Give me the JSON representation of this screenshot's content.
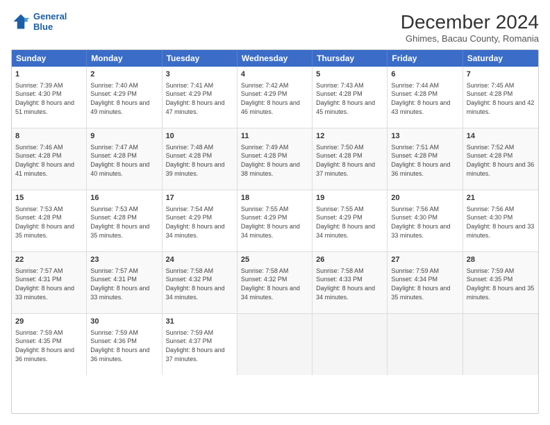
{
  "logo": {
    "line1": "General",
    "line2": "Blue"
  },
  "title": "December 2024",
  "subtitle": "Ghimes, Bacau County, Romania",
  "header_days": [
    "Sunday",
    "Monday",
    "Tuesday",
    "Wednesday",
    "Thursday",
    "Friday",
    "Saturday"
  ],
  "weeks": [
    [
      {
        "day": "1",
        "sunrise": "Sunrise: 7:39 AM",
        "sunset": "Sunset: 4:30 PM",
        "daylight": "Daylight: 8 hours and 51 minutes."
      },
      {
        "day": "2",
        "sunrise": "Sunrise: 7:40 AM",
        "sunset": "Sunset: 4:29 PM",
        "daylight": "Daylight: 8 hours and 49 minutes."
      },
      {
        "day": "3",
        "sunrise": "Sunrise: 7:41 AM",
        "sunset": "Sunset: 4:29 PM",
        "daylight": "Daylight: 8 hours and 47 minutes."
      },
      {
        "day": "4",
        "sunrise": "Sunrise: 7:42 AM",
        "sunset": "Sunset: 4:29 PM",
        "daylight": "Daylight: 8 hours and 46 minutes."
      },
      {
        "day": "5",
        "sunrise": "Sunrise: 7:43 AM",
        "sunset": "Sunset: 4:28 PM",
        "daylight": "Daylight: 8 hours and 45 minutes."
      },
      {
        "day": "6",
        "sunrise": "Sunrise: 7:44 AM",
        "sunset": "Sunset: 4:28 PM",
        "daylight": "Daylight: 8 hours and 43 minutes."
      },
      {
        "day": "7",
        "sunrise": "Sunrise: 7:45 AM",
        "sunset": "Sunset: 4:28 PM",
        "daylight": "Daylight: 8 hours and 42 minutes."
      }
    ],
    [
      {
        "day": "8",
        "sunrise": "Sunrise: 7:46 AM",
        "sunset": "Sunset: 4:28 PM",
        "daylight": "Daylight: 8 hours and 41 minutes."
      },
      {
        "day": "9",
        "sunrise": "Sunrise: 7:47 AM",
        "sunset": "Sunset: 4:28 PM",
        "daylight": "Daylight: 8 hours and 40 minutes."
      },
      {
        "day": "10",
        "sunrise": "Sunrise: 7:48 AM",
        "sunset": "Sunset: 4:28 PM",
        "daylight": "Daylight: 8 hours and 39 minutes."
      },
      {
        "day": "11",
        "sunrise": "Sunrise: 7:49 AM",
        "sunset": "Sunset: 4:28 PM",
        "daylight": "Daylight: 8 hours and 38 minutes."
      },
      {
        "day": "12",
        "sunrise": "Sunrise: 7:50 AM",
        "sunset": "Sunset: 4:28 PM",
        "daylight": "Daylight: 8 hours and 37 minutes."
      },
      {
        "day": "13",
        "sunrise": "Sunrise: 7:51 AM",
        "sunset": "Sunset: 4:28 PM",
        "daylight": "Daylight: 8 hours and 36 minutes."
      },
      {
        "day": "14",
        "sunrise": "Sunrise: 7:52 AM",
        "sunset": "Sunset: 4:28 PM",
        "daylight": "Daylight: 8 hours and 36 minutes."
      }
    ],
    [
      {
        "day": "15",
        "sunrise": "Sunrise: 7:53 AM",
        "sunset": "Sunset: 4:28 PM",
        "daylight": "Daylight: 8 hours and 35 minutes."
      },
      {
        "day": "16",
        "sunrise": "Sunrise: 7:53 AM",
        "sunset": "Sunset: 4:28 PM",
        "daylight": "Daylight: 8 hours and 35 minutes."
      },
      {
        "day": "17",
        "sunrise": "Sunrise: 7:54 AM",
        "sunset": "Sunset: 4:29 PM",
        "daylight": "Daylight: 8 hours and 34 minutes."
      },
      {
        "day": "18",
        "sunrise": "Sunrise: 7:55 AM",
        "sunset": "Sunset: 4:29 PM",
        "daylight": "Daylight: 8 hours and 34 minutes."
      },
      {
        "day": "19",
        "sunrise": "Sunrise: 7:55 AM",
        "sunset": "Sunset: 4:29 PM",
        "daylight": "Daylight: 8 hours and 34 minutes."
      },
      {
        "day": "20",
        "sunrise": "Sunrise: 7:56 AM",
        "sunset": "Sunset: 4:30 PM",
        "daylight": "Daylight: 8 hours and 33 minutes."
      },
      {
        "day": "21",
        "sunrise": "Sunrise: 7:56 AM",
        "sunset": "Sunset: 4:30 PM",
        "daylight": "Daylight: 8 hours and 33 minutes."
      }
    ],
    [
      {
        "day": "22",
        "sunrise": "Sunrise: 7:57 AM",
        "sunset": "Sunset: 4:31 PM",
        "daylight": "Daylight: 8 hours and 33 minutes."
      },
      {
        "day": "23",
        "sunrise": "Sunrise: 7:57 AM",
        "sunset": "Sunset: 4:31 PM",
        "daylight": "Daylight: 8 hours and 33 minutes."
      },
      {
        "day": "24",
        "sunrise": "Sunrise: 7:58 AM",
        "sunset": "Sunset: 4:32 PM",
        "daylight": "Daylight: 8 hours and 34 minutes."
      },
      {
        "day": "25",
        "sunrise": "Sunrise: 7:58 AM",
        "sunset": "Sunset: 4:32 PM",
        "daylight": "Daylight: 8 hours and 34 minutes."
      },
      {
        "day": "26",
        "sunrise": "Sunrise: 7:58 AM",
        "sunset": "Sunset: 4:33 PM",
        "daylight": "Daylight: 8 hours and 34 minutes."
      },
      {
        "day": "27",
        "sunrise": "Sunrise: 7:59 AM",
        "sunset": "Sunset: 4:34 PM",
        "daylight": "Daylight: 8 hours and 35 minutes."
      },
      {
        "day": "28",
        "sunrise": "Sunrise: 7:59 AM",
        "sunset": "Sunset: 4:35 PM",
        "daylight": "Daylight: 8 hours and 35 minutes."
      }
    ],
    [
      {
        "day": "29",
        "sunrise": "Sunrise: 7:59 AM",
        "sunset": "Sunset: 4:35 PM",
        "daylight": "Daylight: 8 hours and 36 minutes."
      },
      {
        "day": "30",
        "sunrise": "Sunrise: 7:59 AM",
        "sunset": "Sunset: 4:36 PM",
        "daylight": "Daylight: 8 hours and 36 minutes."
      },
      {
        "day": "31",
        "sunrise": "Sunrise: 7:59 AM",
        "sunset": "Sunset: 4:37 PM",
        "daylight": "Daylight: 8 hours and 37 minutes."
      },
      {
        "day": "",
        "sunrise": "",
        "sunset": "",
        "daylight": ""
      },
      {
        "day": "",
        "sunrise": "",
        "sunset": "",
        "daylight": ""
      },
      {
        "day": "",
        "sunrise": "",
        "sunset": "",
        "daylight": ""
      },
      {
        "day": "",
        "sunrise": "",
        "sunset": "",
        "daylight": ""
      }
    ]
  ]
}
